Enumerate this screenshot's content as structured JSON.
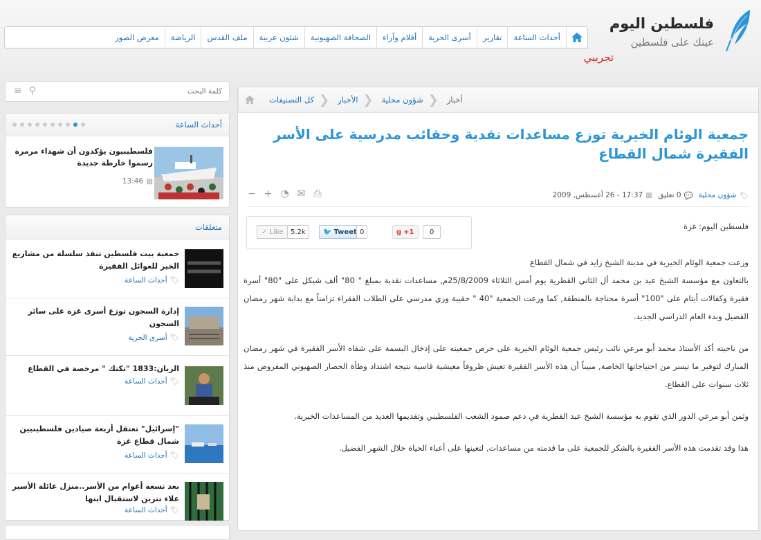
{
  "header": {
    "logo_title": "فلسطين اليوم",
    "logo_subtitle": "عينك على فلسطين",
    "logo_beta": "تجريبي"
  },
  "nav": {
    "items": [
      "أحداث الساعة",
      "تقارير",
      "أسرى الحرية",
      "أقلام وآراء",
      "الصحافة الصهيونية",
      "شئون عربية",
      "ملف القدس",
      "الرياضة",
      "معرض الصور"
    ]
  },
  "breadcrumbs": [
    "كل التصنيفات",
    "الأخبار",
    "شؤون محلية",
    "أخبار"
  ],
  "article": {
    "title": "جمعية الوئام الخيرية توزع مساعدات نقدية وحقائب مدرسية على الأسر الفقيرة شمال القطاع",
    "category": "شؤون محلية",
    "comments": "0 تعليق",
    "datetime": "17:37 - 26 أغسطس, 2009",
    "source": "فلسطين اليوم: غزة",
    "paragraphs": [
      "وزعت جمعية الوئام الخيرية في مدينة الشيخ زايد في شمال القطاع",
      "بالتعاون مع مؤسسة الشيخ عيد بن محمد أل الثاني القطرية يوم أمس الثلاثاء 25/8/2009م, مساعدات نقدية بمبلغ \" 80\" ألف شيكل على \"80\" أسرة فقيرة وكفالات أيتام على \"100\" أسرة محتاجة بالمنطقة, كما وزعت الجمعية \"40 \" حقيبة وزي مدرسي على الطلاب الفقراء تزامناً مع بداية شهر رمضان الفضيل وبدء العام الدراسي الجديد.",
      "من ناحيته أكد الأستاذ محمد أبو مرعي نائب رئيس جمعية الوئام الخيرية على حرص جمعيته على إدخال البسمة على شفاه الأسر الفقيرة في شهر رمضان المبارك لتوفير ما تيسر من احتياجاتها الخاصة, مبيناً أن هذه الأسر الفقيرة تعيش ظروفاً معيشية قاسية نتيجة اشتداد وطأة الحصار الصهيوني المفروض منذ ثلاث سنوات على القطاع.",
      "وثمن أبو مرعي الدور الذي تقوم به مؤسسة الشيخ عيد القطرية في دعم صمود الشعب الفلسطيني وتقديمها العديد من المساعدات الخيرية.",
      "هذا وقد تقدمت هذه الأسر الفقيرة بالشكر للجمعية على ما قدمته من مساعدات, لتعينها على أعباء الحياة خلال الشهر الفضيل."
    ]
  },
  "social": {
    "like_label": "Like",
    "like_count": "5.2k",
    "tweet_label": "Tweet",
    "tweet_count": "0",
    "gplus_label": "+1",
    "gplus_count": "0"
  },
  "sidebar": {
    "search_placeholder": "كلمة البحث",
    "breaking": {
      "heading": "أحداث الساعة",
      "slide_count": 10,
      "active_slide": 1,
      "title": "فلسطينيون يؤكدون أن شهداء مرمرة رسموا خارطة جديدة",
      "time": "13:46"
    },
    "related": {
      "heading": "متعلقات",
      "items": [
        {
          "title": "جمعية بيت فلسطين تنفذ سلسلة من مشاريع الخير للعوائل الفقيرة",
          "category": "أحداث الساعة"
        },
        {
          "title": "إدارة السجون توزع أسرى غزة على سائر السجون",
          "category": "أسرى الحرية"
        },
        {
          "title": "الزيان:1833 \"تكتك \" مرخصة في القطاع",
          "category": "أحداث الساعة"
        },
        {
          "title": "\"إسرائيل\" تعتقل أربعة صيادين فلسطينيين شمال قطاع غزة",
          "category": "أحداث الساعة"
        },
        {
          "title": "بعد تسعة أعوام من الأسر..منزل عائلة الأسير علاء تتزين لاستقبال ابنها",
          "category": "أحداث الساعة"
        }
      ]
    }
  },
  "colors": {
    "accent": "#2b95d6",
    "link": "#1d71b8",
    "beta": "#d0201b"
  }
}
